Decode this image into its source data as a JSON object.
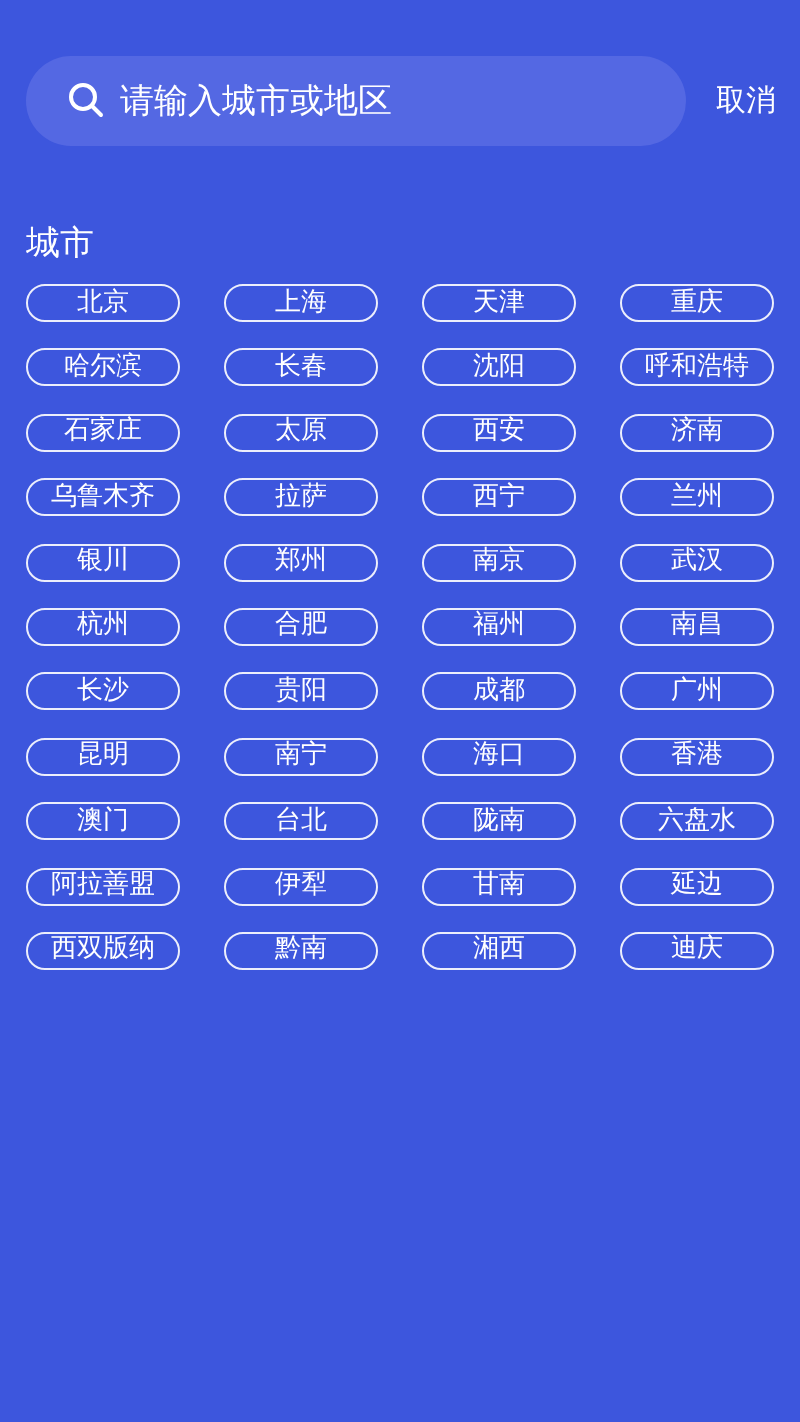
{
  "search": {
    "placeholder": "请输入城市或地区"
  },
  "cancel_button": "取消",
  "section_title": "城市",
  "cities": [
    "北京",
    "上海",
    "天津",
    "重庆",
    "哈尔滨",
    "长春",
    "沈阳",
    "呼和浩特",
    "石家庄",
    "太原",
    "西安",
    "济南",
    "乌鲁木齐",
    "拉萨",
    "西宁",
    "兰州",
    "银川",
    "郑州",
    "南京",
    "武汉",
    "杭州",
    "合肥",
    "福州",
    "南昌",
    "长沙",
    "贵阳",
    "成都",
    "广州",
    "昆明",
    "南宁",
    "海口",
    "香港",
    "澳门",
    "台北",
    "陇南",
    "六盘水",
    "阿拉善盟",
    "伊犁",
    "甘南",
    "延边",
    "西双版纳",
    "黔南",
    "湘西",
    "迪庆"
  ]
}
